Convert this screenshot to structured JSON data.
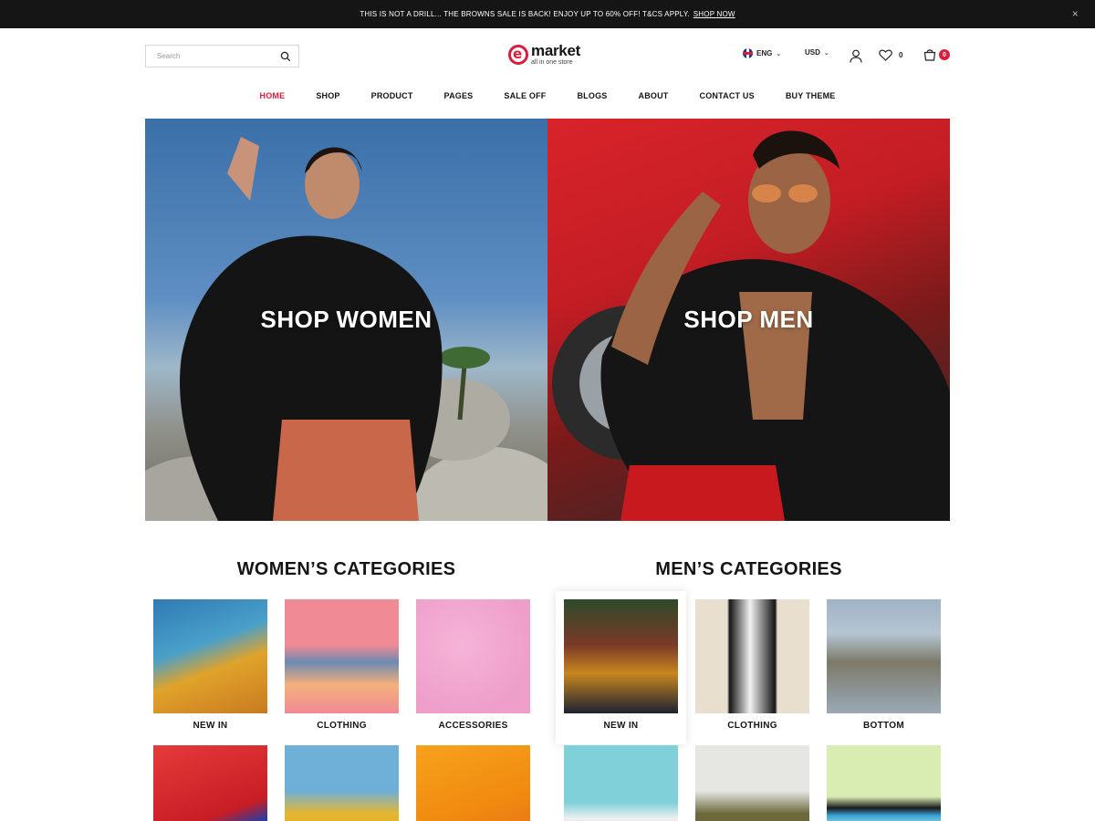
{
  "announcement": {
    "text": "THIS IS NOT A DRILL... THE BROWNS SALE IS BACK! ENJOY UP TO 60% OFF! T&CS APPLY.",
    "link": "SHOP NOW",
    "close": "×"
  },
  "header": {
    "search_placeholder": "Search",
    "logo_name": "market",
    "logo_letter": "e",
    "logo_tagline": "all in one store",
    "language": "ENG",
    "currency": "USD",
    "wishlist_count": "0",
    "cart_count": "0"
  },
  "nav": [
    "HOME",
    "SHOP",
    "PRODUCT",
    "PAGES",
    "SALE OFF",
    "BLOGS",
    "ABOUT",
    "CONTACT US",
    "BUY THEME"
  ],
  "hero": {
    "women_label": "SHOP WOMEN",
    "men_label": "SHOP MEN"
  },
  "women_categories": {
    "title": "WOMEN’S CATEGORIES",
    "items": [
      "NEW IN",
      "CLOTHING",
      "ACCESSORIES"
    ]
  },
  "men_categories": {
    "title": "MEN’S CATEGORIES",
    "items": [
      "NEW IN",
      "CLOTHING",
      "BOTTOM"
    ]
  },
  "colors": {
    "accent": "#d91e3d",
    "topbar": "#151515"
  }
}
